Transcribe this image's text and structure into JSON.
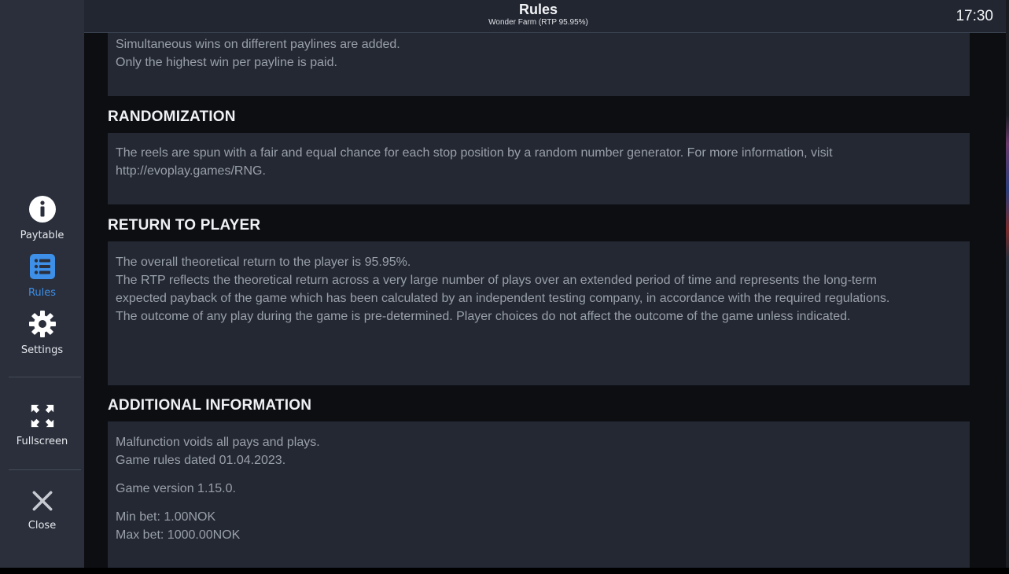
{
  "header": {
    "title": "Rules",
    "subtitle": "Wonder Farm (RTP 95.95%)",
    "time": "17:30"
  },
  "sidebar": {
    "items": [
      {
        "label": "Paytable",
        "icon": "info-icon",
        "active": false
      },
      {
        "label": "Rules",
        "icon": "list-icon",
        "active": true
      },
      {
        "label": "Settings",
        "icon": "gear-icon",
        "active": false
      },
      {
        "label": "Fullscreen",
        "icon": "fullscreen-icon",
        "active": false
      },
      {
        "label": "Close",
        "icon": "close-icon",
        "active": false
      }
    ],
    "active_color": "#3d8fe8"
  },
  "sections": {
    "paylines": {
      "lines": [
        "Simultaneous wins on different paylines are added.",
        "Only the highest win per payline is paid."
      ]
    },
    "randomization": {
      "heading": "RANDOMIZATION",
      "lines": [
        "The reels are spun with a fair and equal chance for each stop position by a random number generator. For more information, visit http://evoplay.games/RNG."
      ]
    },
    "return_to_player": {
      "heading": "RETURN TO PLAYER",
      "lines": [
        "The overall theoretical return to the player is 95.95%.",
        "The RTP reflects the theoretical return across a very large number of plays over an extended period of time and represents the long-term expected payback of the game which has been calculated by an independent testing company, in accordance with the required regulations.",
        "The outcome of any play during the game is pre-determined. Player choices do not affect the outcome of the game unless indicated."
      ]
    },
    "additional_information": {
      "heading": "ADDITIONAL INFORMATION",
      "malfunction": "Malfunction voids all pays and plays.",
      "rules_date": "Game rules dated 01.04.2023.",
      "version": "Game version 1.15.0.",
      "min_bet": "Min bet: 1.00NOK",
      "max_bet": "Max bet: 1000.00NOK"
    }
  }
}
